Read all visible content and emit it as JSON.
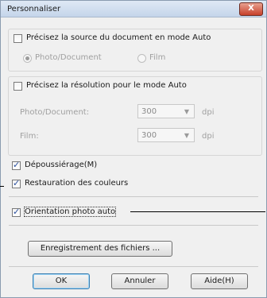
{
  "window": {
    "title": "Personnaliser",
    "close_label": "X"
  },
  "source_group": {
    "checkbox_label": "Précisez la source du document en mode Auto",
    "checked": false,
    "options": [
      {
        "label": "Photo/Document",
        "selected": true
      },
      {
        "label": "Film",
        "selected": false
      }
    ]
  },
  "resolution_group": {
    "checkbox_label": "Précisez la résolution pour le mode Auto",
    "checked": false,
    "rows": [
      {
        "label": "Photo/Document:",
        "value": "300",
        "unit": "dpi"
      },
      {
        "label": "Film:",
        "value": "300",
        "unit": "dpi"
      }
    ]
  },
  "options": {
    "dust_removal": {
      "label": "Dépoussiérage(M)",
      "checked": true
    },
    "color_restoration": {
      "label": "Restauration des couleurs",
      "checked": true
    },
    "auto_photo_orientation": {
      "label": "Orientation photo auto",
      "checked": true
    }
  },
  "file_save_button": "Enregistrement des fichiers ...",
  "footer": {
    "ok_label": "OK",
    "cancel_label": "Annuler",
    "help_label": "Aide(H)"
  },
  "icons": {
    "dropdown": "chevron-down-icon",
    "checkmark": "checkmark-icon"
  }
}
